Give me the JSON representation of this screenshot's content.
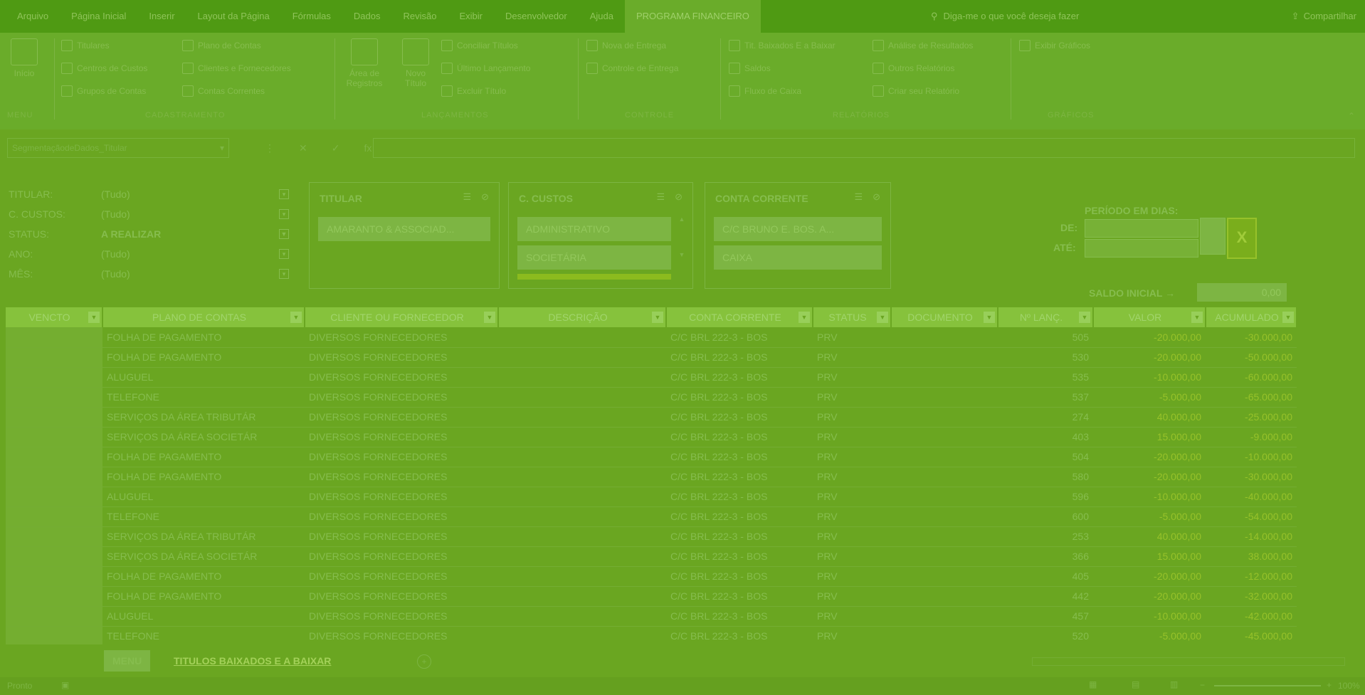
{
  "tabs": [
    "Arquivo",
    "Página Inicial",
    "Inserir",
    "Layout da Página",
    "Fórmulas",
    "Dados",
    "Revisão",
    "Exibir",
    "Desenvolvedor",
    "Ajuda",
    "PROGRAMA FINANCEIRO"
  ],
  "tell_me": "Diga-me o que você deseja fazer",
  "share": "Compartilhar",
  "ribbon": {
    "menu_label": "Início",
    "cadastros": [
      "Titulares",
      "Centros de Custos",
      "Grupos de Contas",
      "Plano de Contas",
      "Clientes e Fornecedores",
      "Contas Correntes"
    ],
    "lanc_big": [
      "Área de Registros",
      "Novo Título"
    ],
    "lanc": [
      "Conciliar Títulos",
      "Último Lançamento",
      "Excluir Título"
    ],
    "controle": [
      "Nova de Entrega",
      "Controle de Entrega"
    ],
    "relatorios_a": [
      "Tit. Baixados E a Baixar",
      "Saldos",
      "Fluxo de Caixa"
    ],
    "relatorios_b": [
      "Análise de Resultados",
      "Outros Relatórios",
      "Criar seu Relatório"
    ],
    "graficos": [
      "Exibir Gráficos"
    ],
    "groups": [
      "MENU",
      "CADASTRAMENTO",
      "LANÇAMENTOS",
      "CONTROLE",
      "RELATÓRIOS",
      "GRÁFICOS"
    ]
  },
  "formula": {
    "namebox": "SegmentaçãodeDados_Titular",
    "icons": [
      "⋮",
      "✕",
      "✓",
      "fx"
    ]
  },
  "filters": [
    {
      "label": "TITULAR:",
      "value": "(Tudo)"
    },
    {
      "label": "C. CUSTOS:",
      "value": "(Tudo)"
    },
    {
      "label": "STATUS:",
      "value": "A REALIZAR"
    },
    {
      "label": "ANO:",
      "value": "(Tudo)"
    },
    {
      "label": "MÊS:",
      "value": "(Tudo)"
    }
  ],
  "slicers": [
    {
      "title": "TITULAR",
      "items": [
        "AMARANTO & ASSOCIAD..."
      ]
    },
    {
      "title": "C. CUSTOS",
      "items": [
        "ADMINISTRATIVO",
        "SOCIETÁRIA"
      ]
    },
    {
      "title": "CONTA CORRENTE",
      "items": [
        "C/C BRUNO E. BOS. A...",
        "CAIXA"
      ]
    }
  ],
  "period": {
    "title": "PERÍODO EM DIAS:",
    "from": "DE:",
    "to": "ATÉ:"
  },
  "saldo": {
    "label": "SALDO INICIAL →",
    "value": "0,00"
  },
  "table": {
    "columns": [
      "VENCTO",
      "PLANO DE CONTAS",
      "CLIENTE OU FORNECEDOR",
      "DESCRIÇÃO",
      "CONTA CORRENTE",
      "STATUS",
      "DOCUMENTO",
      "Nº LANÇ.",
      "VALOR",
      "ACUMULADO"
    ],
    "rows": [
      {
        "plano": "FOLHA DE PAGAMENTO",
        "cli": "DIVERSOS FORNECEDORES",
        "cc": "C/C BRL 222-3 - BOS",
        "st": "PRV",
        "nl": "505",
        "val": "-20.000,00",
        "ac": "-30.000,00"
      },
      {
        "plano": "FOLHA DE PAGAMENTO",
        "cli": "DIVERSOS FORNECEDORES",
        "cc": "C/C BRL 222-3 - BOS",
        "st": "PRV",
        "nl": "530",
        "val": "-20.000,00",
        "ac": "-50.000,00"
      },
      {
        "plano": "ALUGUEL",
        "cli": "DIVERSOS FORNECEDORES",
        "cc": "C/C BRL 222-3 - BOS",
        "st": "PRV",
        "nl": "535",
        "val": "-10.000,00",
        "ac": "-60.000,00"
      },
      {
        "plano": "TELEFONE",
        "cli": "DIVERSOS FORNECEDORES",
        "cc": "C/C BRL 222-3 - BOS",
        "st": "PRV",
        "nl": "537",
        "val": "-5.000,00",
        "ac": "-65.000,00"
      },
      {
        "plano": "SERVIÇOS DA ÁREA TRIBUTÁR",
        "cli": "DIVERSOS FORNECEDORES",
        "cc": "C/C BRL 222-3 - BOS",
        "st": "PRV",
        "nl": "274",
        "val": "40.000,00",
        "ac": "-25.000,00"
      },
      {
        "plano": "SERVIÇOS DA ÁREA SOCIETÁR",
        "cli": "DIVERSOS FORNECEDORES",
        "cc": "C/C BRL 222-3 - BOS",
        "st": "PRV",
        "nl": "403",
        "val": "15.000,00",
        "ac": "-9.000,00"
      },
      {
        "plano": "FOLHA DE PAGAMENTO",
        "cli": "DIVERSOS FORNECEDORES",
        "cc": "C/C BRL 222-3 - BOS",
        "st": "PRV",
        "nl": "504",
        "val": "-20.000,00",
        "ac": "-10.000,00"
      },
      {
        "plano": "FOLHA DE PAGAMENTO",
        "cli": "DIVERSOS FORNECEDORES",
        "cc": "C/C BRL 222-3 - BOS",
        "st": "PRV",
        "nl": "580",
        "val": "-20.000,00",
        "ac": "-30.000,00"
      },
      {
        "plano": "ALUGUEL",
        "cli": "DIVERSOS FORNECEDORES",
        "cc": "C/C BRL 222-3 - BOS",
        "st": "PRV",
        "nl": "596",
        "val": "-10.000,00",
        "ac": "-40.000,00"
      },
      {
        "plano": "TELEFONE",
        "cli": "DIVERSOS FORNECEDORES",
        "cc": "C/C BRL 222-3 - BOS",
        "st": "PRV",
        "nl": "600",
        "val": "-5.000,00",
        "ac": "-54.000,00"
      },
      {
        "plano": "SERVIÇOS DA ÁREA TRIBUTÁR",
        "cli": "DIVERSOS FORNECEDORES",
        "cc": "C/C BRL 222-3 - BOS",
        "st": "PRV",
        "nl": "253",
        "val": "40.000,00",
        "ac": "-14.000,00"
      },
      {
        "plano": "SERVIÇOS DA ÁREA SOCIETÁR",
        "cli": "DIVERSOS FORNECEDORES",
        "cc": "C/C BRL 222-3 - BOS",
        "st": "PRV",
        "nl": "366",
        "val": "15.000,00",
        "ac": "38.000,00"
      },
      {
        "plano": "FOLHA DE PAGAMENTO",
        "cli": "DIVERSOS FORNECEDORES",
        "cc": "C/C BRL 222-3 - BOS",
        "st": "PRV",
        "nl": "405",
        "val": "-20.000,00",
        "ac": "-12.000,00"
      },
      {
        "plano": "FOLHA DE PAGAMENTO",
        "cli": "DIVERSOS FORNECEDORES",
        "cc": "C/C BRL 222-3 - BOS",
        "st": "PRV",
        "nl": "442",
        "val": "-20.000,00",
        "ac": "-32.000,00"
      },
      {
        "plano": "ALUGUEL",
        "cli": "DIVERSOS FORNECEDORES",
        "cc": "C/C BRL 222-3 - BOS",
        "st": "PRV",
        "nl": "457",
        "val": "-10.000,00",
        "ac": "-42.000,00"
      },
      {
        "plano": "TELEFONE",
        "cli": "DIVERSOS FORNECEDORES",
        "cc": "C/C BRL 222-3 - BOS",
        "st": "PRV",
        "nl": "520",
        "val": "-5.000,00",
        "ac": "-45.000,00"
      }
    ]
  },
  "sheet_tabs": [
    "MENU",
    "TITULOS BAIXADOS E A BAIXAR"
  ],
  "status": {
    "ready": "Pronto",
    "zoom": "100%"
  },
  "colors": {
    "overlay_green": "#6aa621",
    "accent": "#97c22a"
  }
}
